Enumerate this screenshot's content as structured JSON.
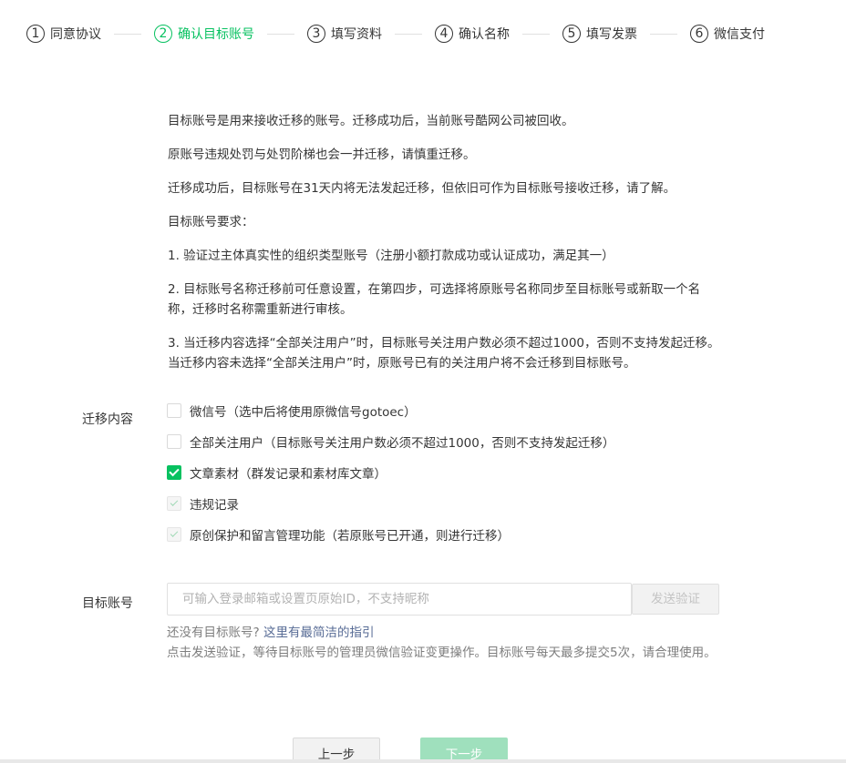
{
  "steps": [
    {
      "num": "1",
      "label": "同意协议"
    },
    {
      "num": "2",
      "label": "确认目标账号"
    },
    {
      "num": "3",
      "label": "填写资料"
    },
    {
      "num": "4",
      "label": "确认名称"
    },
    {
      "num": "5",
      "label": "填写发票"
    },
    {
      "num": "6",
      "label": "微信支付"
    }
  ],
  "active_step": 2,
  "description": [
    "目标账号是用来接收迁移的账号。迁移成功后，当前账号酷网公司被回收。",
    "原账号违规处罚与处罚阶梯也会一并迁移，请慎重迁移。",
    "迁移成功后，目标账号在31天内将无法发起迁移，但依旧可作为目标账号接收迁移，请了解。",
    "目标账号要求：",
    "1. 验证过主体真实性的组织类型账号（注册小额打款成功或认证成功，满足其一）",
    "2. 目标账号名称迁移前可任意设置，在第四步，可选择将原账号名称同步至目标账号或新取一个名称，迁移时名称需重新进行审核。",
    "3. 当迁移内容选择“全部关注用户”时，目标账号关注用户数必须不超过1000，否则不支持发起迁移。当迁移内容未选择“全部关注用户”时，原账号已有的关注用户将不会迁移到目标账号。"
  ],
  "migrate": {
    "label": "迁移内容",
    "options": [
      {
        "label": "微信号（选中后将使用原微信号gotoec）",
        "state": "unchecked"
      },
      {
        "label": "全部关注用户（目标账号关注用户数必须不超过1000，否则不支持发起迁移）",
        "state": "unchecked"
      },
      {
        "label": "文章素材（群发记录和素材库文章）",
        "state": "checked"
      },
      {
        "label": "违规记录",
        "state": "disabled-checked"
      },
      {
        "label": "原创保护和留言管理功能（若原账号已开通，则进行迁移）",
        "state": "disabled-checked"
      }
    ]
  },
  "target": {
    "label": "目标账号",
    "placeholder": "可输入登录邮箱或设置页原始ID，不支持昵称",
    "value": "",
    "send_label": "发送验证"
  },
  "hint": {
    "prefix": "还没有目标账号?",
    "link": "这里有最简洁的指引",
    "note": "点击发送验证，等待目标账号的管理员微信验证变更操作。目标账号每天最多提交5次，请合理使用。"
  },
  "footer": {
    "prev_label": "上一步",
    "next_label": "下一步"
  }
}
